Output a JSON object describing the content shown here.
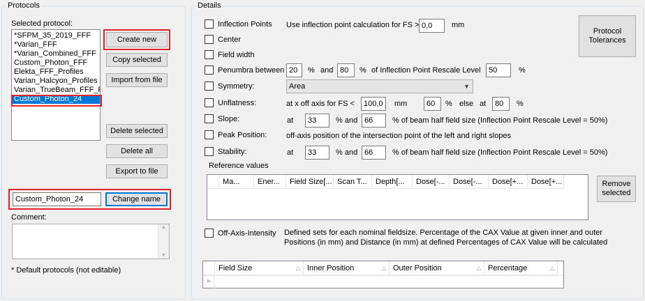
{
  "protocols": {
    "title": "Protocols",
    "selected_label": "Selected protocol:",
    "items": [
      "*SFPM_35_2019_FFF",
      "*Varian_FFF",
      "*Varian_Combined_FFF",
      "Custom_Photon_FFF",
      "Elekta_FFF_Profiles",
      "Varian_Halcyon_Profiles",
      "Varian_TrueBeam_FFF_F",
      "Custom_Photon_24"
    ],
    "selected_index": 7,
    "buttons": {
      "create_new": "Create new",
      "copy_selected": "Copy selected",
      "import_from_file": "Import from file",
      "delete_selected": "Delete selected",
      "delete_all": "Delete all",
      "export_to_file": "Export to file",
      "change_name": "Change name"
    },
    "name_value": "Custom_Photon_24",
    "comment_label": "Comment:",
    "comment_value": "",
    "footnote": "* Default protocols (not editable)"
  },
  "details": {
    "title": "Details",
    "tolerances_button": "Protocol\nTolerances",
    "inflection": {
      "label": "Inflection Points",
      "text": "Use inflection point calculation for FS >",
      "value": "0,0",
      "unit": "mm",
      "checked": false
    },
    "center": {
      "label": "Center",
      "checked": false
    },
    "field_width": {
      "label": "Field width",
      "checked": false
    },
    "penumbra": {
      "label": "Penumbra between",
      "low": "20",
      "pct1": "%",
      "and": "and",
      "high": "80",
      "pct2": "%",
      "of_text": "of Inflection Point Rescale Level",
      "rescale": "50",
      "pct3": "%",
      "checked": false
    },
    "symmetry": {
      "label": "Symmetry:",
      "selected": "Area",
      "checked": false
    },
    "unflatness": {
      "label": "Unflatness:",
      "text": "at x off axis for FS <",
      "fs": "100,0",
      "unit": "mm",
      "pct_value": "60",
      "pct": "%",
      "else": "else",
      "at": "at",
      "else_value": "80",
      "pct2": "%",
      "checked": false
    },
    "slope": {
      "label": "Slope:",
      "at": "at",
      "v1": "33",
      "pct_and": "% and",
      "v2": "66",
      "tail": "% of beam half field size  (Inflection Point Rescale Level = 50%)",
      "checked": false
    },
    "peak_position": {
      "label": "Peak Position:",
      "text": "off-axis position of the intersection point of the left and right slopes",
      "checked": false
    },
    "stability": {
      "label": "Stability:",
      "at": "at",
      "v1": "33",
      "pct_and": "% and",
      "v2": "66",
      "tail": "% of beam half field size  (Inflection Point Rescale Level = 50%)",
      "checked": false
    },
    "reference": {
      "label": "Reference values",
      "columns": [
        "Ma...",
        "Ener...",
        "Field Size[...",
        "Scan T...",
        "Depth[...",
        "Dose[-...",
        "Dose[-...",
        "Dose[+...",
        "Dose[+..."
      ],
      "remove_button": "Remove\nselected"
    },
    "oai": {
      "label": "Off-Axis-Intensity",
      "description": "Defined sets for each nominal fieldsize. Percentage of the CAX Value at given inner and outer Positions (in mm) and Distance (in mm) at defined Percentages of CAX Value will be calculated",
      "checked": false,
      "columns": [
        "Field Size",
        "Inner Position",
        "Outer Position",
        "Percentage"
      ]
    }
  },
  "colors": {
    "highlight": "#e0242a",
    "selection": "#0078d7",
    "background": "#f0f0f0"
  }
}
